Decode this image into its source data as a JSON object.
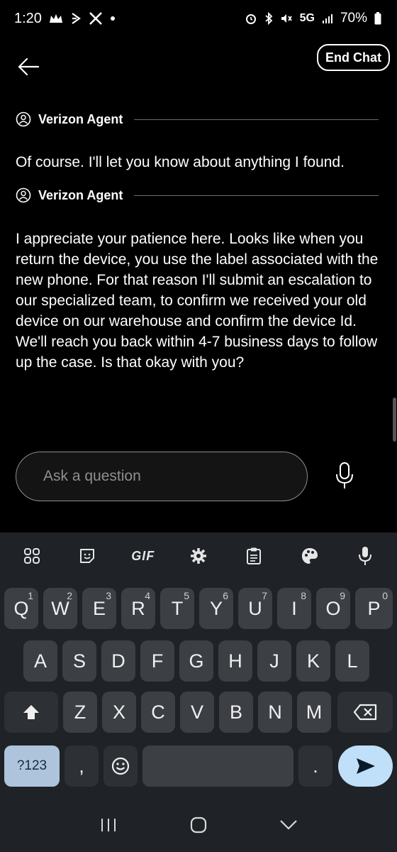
{
  "status_bar": {
    "time": "1:20",
    "network": "5G",
    "battery": "70%"
  },
  "header": {
    "back_icon": "arrow-left-icon",
    "end_chat_label": "End Chat"
  },
  "messages": [
    {
      "sender": "Verizon Agent",
      "text": "Of course. I'll let you know about anything I found."
    },
    {
      "sender": "Verizon Agent",
      "text": "I appreciate your patience here. Looks like when you return the device, you use the label associated with the new phone. For that reason I'll submit an escalation to our specialized team, to confirm we received your old device on our warehouse and confirm the device Id. We'll reach you back within 4-7 business days to follow up the case. Is that okay with you?"
    }
  ],
  "input": {
    "placeholder": "Ask a question"
  },
  "keyboard": {
    "toolbar_gif": "GIF",
    "row1": [
      {
        "key": "Q",
        "hint": "1"
      },
      {
        "key": "W",
        "hint": "2"
      },
      {
        "key": "E",
        "hint": "3"
      },
      {
        "key": "R",
        "hint": "4"
      },
      {
        "key": "T",
        "hint": "5"
      },
      {
        "key": "Y",
        "hint": "6"
      },
      {
        "key": "U",
        "hint": "7"
      },
      {
        "key": "I",
        "hint": "8"
      },
      {
        "key": "O",
        "hint": "9"
      },
      {
        "key": "P",
        "hint": "0"
      }
    ],
    "row2": [
      "A",
      "S",
      "D",
      "F",
      "G",
      "H",
      "J",
      "K",
      "L"
    ],
    "row3": [
      "Z",
      "X",
      "C",
      "V",
      "B",
      "N",
      "M"
    ],
    "symbols_label": "?123",
    "comma_label": ",",
    "period_label": "."
  },
  "colors": {
    "background": "#000000",
    "keyboard_bg": "#1f2227",
    "key_bg": "#3c3f44",
    "enter_key": "#bfe0f8",
    "symbols_key": "#aec4dc"
  }
}
